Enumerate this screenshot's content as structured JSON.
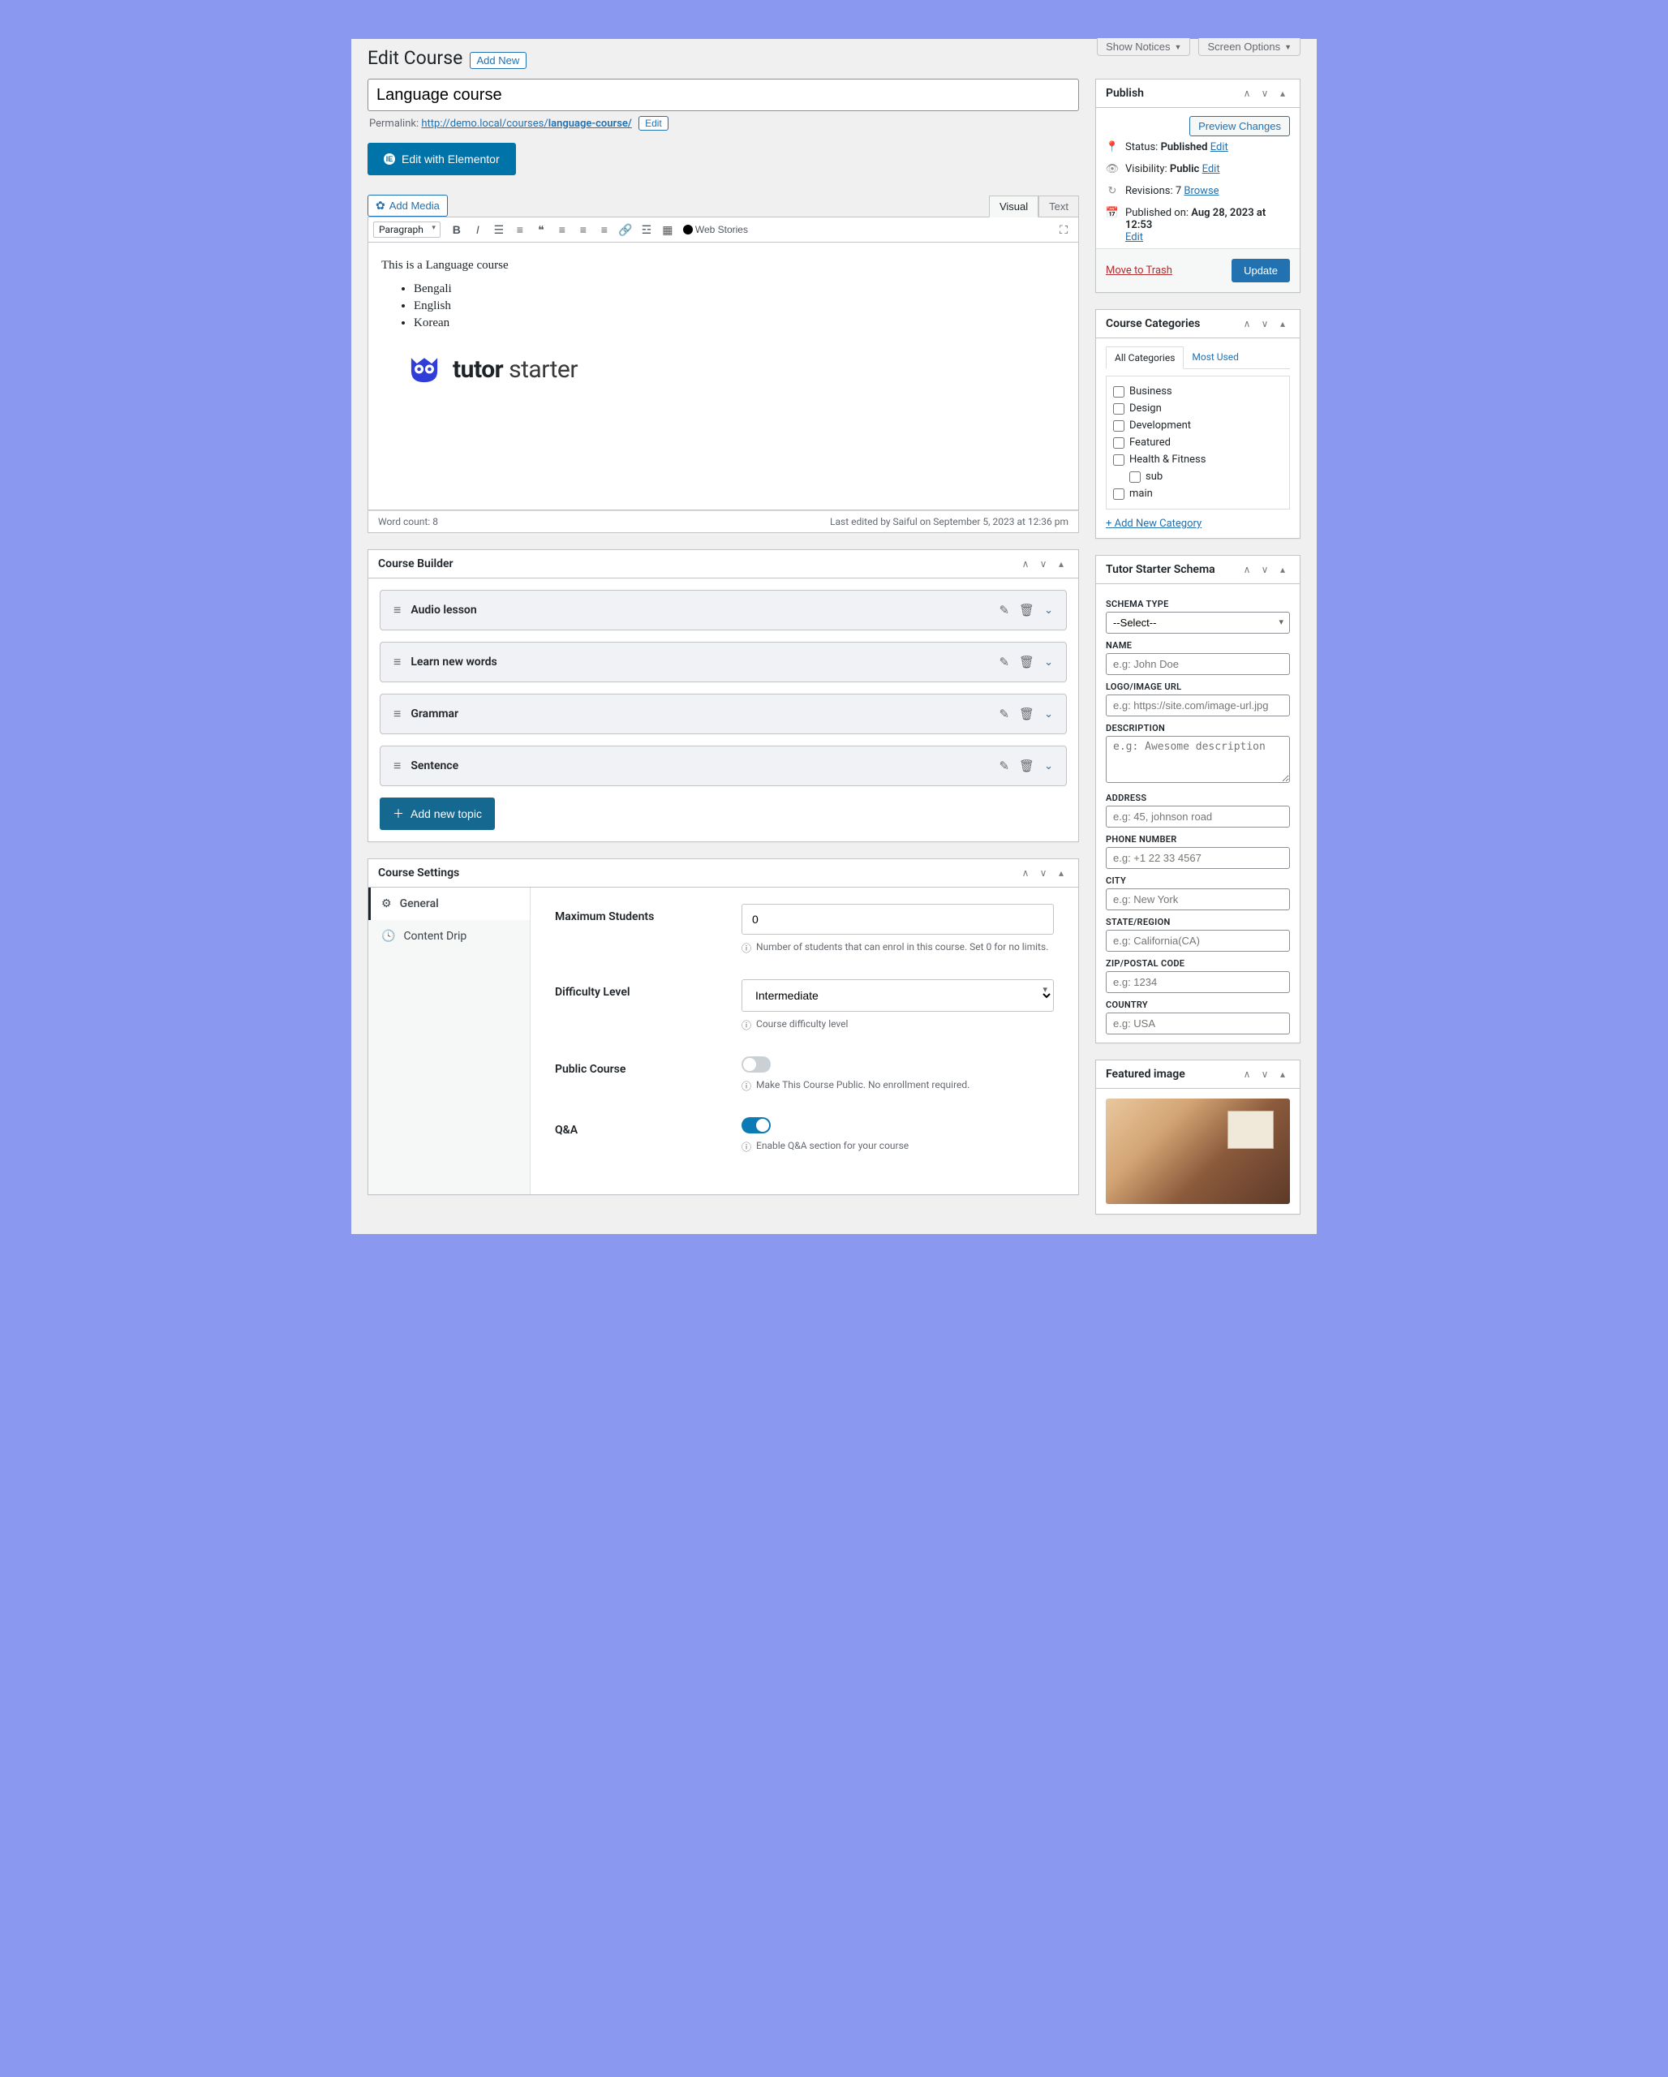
{
  "screen": {
    "show_notices": "Show Notices",
    "screen_options": "Screen Options"
  },
  "page": {
    "title": "Edit Course",
    "add_new": "Add New"
  },
  "course": {
    "title": "Language course",
    "permalink_label": "Permalink:",
    "permalink_base": "http://demo.local/courses/",
    "permalink_slug": "language-course/",
    "edit_slug": "Edit"
  },
  "elementor_btn": "Edit with Elementor",
  "editor": {
    "add_media": "Add Media",
    "tab_visual": "Visual",
    "tab_text": "Text",
    "format": "Paragraph",
    "web_stories": "Web Stories",
    "body_intro": "This is a Language course",
    "languages": [
      "Bengali",
      "English",
      "Korean"
    ],
    "logo_text_bold": "tutor",
    "logo_text_rest": " starter",
    "word_count_label": "Word count:",
    "word_count": "8",
    "last_edited": "Last edited by Saiful on September 5, 2023 at 12:36 pm"
  },
  "publish": {
    "title": "Publish",
    "preview": "Preview Changes",
    "status_label": "Status:",
    "status_value": "Published",
    "status_edit": "Edit",
    "visibility_label": "Visibility:",
    "visibility_value": "Public",
    "visibility_edit": "Edit",
    "revisions_label": "Revisions:",
    "revisions_value": "7",
    "revisions_browse": "Browse",
    "published_on_label": "Published on:",
    "published_on_value": "Aug 28, 2023 at 12:53",
    "published_edit": "Edit",
    "trash": "Move to Trash",
    "update": "Update"
  },
  "categories": {
    "title": "Course Categories",
    "tab_all": "All Categories",
    "tab_most": "Most Used",
    "items": [
      "Business",
      "Design",
      "Development",
      "Featured",
      "Health & Fitness"
    ],
    "sub_item": "sub",
    "last_item": "main",
    "add_new": "+ Add New Category"
  },
  "schema": {
    "title": "Tutor Starter Schema",
    "fields": {
      "type_label": "SCHEMA TYPE",
      "type_value": "--Select--",
      "name_label": "NAME",
      "name_placeholder": "e.g: John Doe",
      "logo_label": "LOGO/IMAGE URL",
      "logo_placeholder": "e.g: https://site.com/image-url.jpg",
      "desc_label": "DESCRIPTION",
      "desc_placeholder": "e.g: Awesome description",
      "address_label": "ADDRESS",
      "address_placeholder": "e.g: 45, johnson road",
      "phone_label": "PHONE NUMBER",
      "phone_placeholder": "e.g: +1 22 33 4567",
      "city_label": "CITY",
      "city_placeholder": "e.g: New York",
      "state_label": "STATE/REGION",
      "state_placeholder": "e.g: California(CA)",
      "zip_label": "ZIP/POSTAL CODE",
      "zip_placeholder": "e.g: 1234",
      "country_label": "COUNTRY",
      "country_placeholder": "e.g: USA"
    }
  },
  "builder": {
    "title": "Course Builder",
    "topics": [
      "Audio lesson",
      "Learn new words",
      "Grammar",
      "Sentence"
    ],
    "add_topic": "Add new topic"
  },
  "settings": {
    "title": "Course Settings",
    "nav_general": "General",
    "nav_drip": "Content Drip",
    "max_students_label": "Maximum Students",
    "max_students_value": "0",
    "max_students_hint": "Number of students that can enrol in this course. Set 0 for no limits.",
    "difficulty_label": "Difficulty Level",
    "difficulty_value": "Intermediate",
    "difficulty_hint": "Course difficulty level",
    "public_label": "Public Course",
    "public_hint": "Make This Course Public. No enrollment required.",
    "qa_label": "Q&A",
    "qa_hint": "Enable Q&A section for your course"
  },
  "featured_image": {
    "title": "Featured image"
  }
}
